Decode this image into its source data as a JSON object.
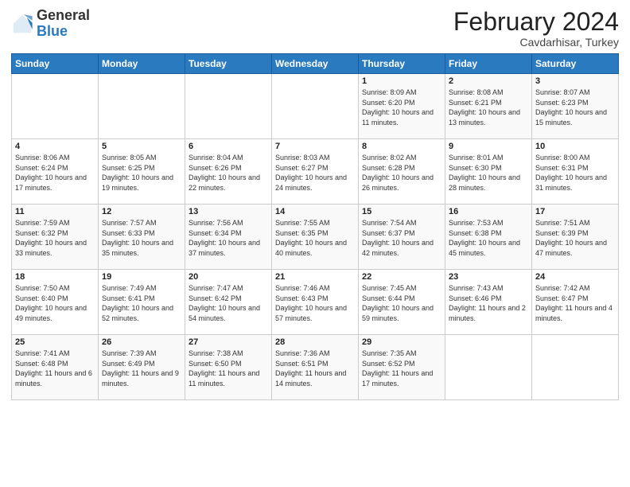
{
  "header": {
    "logo_general": "General",
    "logo_blue": "Blue",
    "month_year": "February 2024",
    "location": "Cavdarhisar, Turkey"
  },
  "days_of_week": [
    "Sunday",
    "Monday",
    "Tuesday",
    "Wednesday",
    "Thursday",
    "Friday",
    "Saturday"
  ],
  "weeks": [
    [
      {
        "day": "",
        "info": ""
      },
      {
        "day": "",
        "info": ""
      },
      {
        "day": "",
        "info": ""
      },
      {
        "day": "",
        "info": ""
      },
      {
        "day": "1",
        "info": "Sunrise: 8:09 AM\nSunset: 6:20 PM\nDaylight: 10 hours and 11 minutes."
      },
      {
        "day": "2",
        "info": "Sunrise: 8:08 AM\nSunset: 6:21 PM\nDaylight: 10 hours and 13 minutes."
      },
      {
        "day": "3",
        "info": "Sunrise: 8:07 AM\nSunset: 6:23 PM\nDaylight: 10 hours and 15 minutes."
      }
    ],
    [
      {
        "day": "4",
        "info": "Sunrise: 8:06 AM\nSunset: 6:24 PM\nDaylight: 10 hours and 17 minutes."
      },
      {
        "day": "5",
        "info": "Sunrise: 8:05 AM\nSunset: 6:25 PM\nDaylight: 10 hours and 19 minutes."
      },
      {
        "day": "6",
        "info": "Sunrise: 8:04 AM\nSunset: 6:26 PM\nDaylight: 10 hours and 22 minutes."
      },
      {
        "day": "7",
        "info": "Sunrise: 8:03 AM\nSunset: 6:27 PM\nDaylight: 10 hours and 24 minutes."
      },
      {
        "day": "8",
        "info": "Sunrise: 8:02 AM\nSunset: 6:28 PM\nDaylight: 10 hours and 26 minutes."
      },
      {
        "day": "9",
        "info": "Sunrise: 8:01 AM\nSunset: 6:30 PM\nDaylight: 10 hours and 28 minutes."
      },
      {
        "day": "10",
        "info": "Sunrise: 8:00 AM\nSunset: 6:31 PM\nDaylight: 10 hours and 31 minutes."
      }
    ],
    [
      {
        "day": "11",
        "info": "Sunrise: 7:59 AM\nSunset: 6:32 PM\nDaylight: 10 hours and 33 minutes."
      },
      {
        "day": "12",
        "info": "Sunrise: 7:57 AM\nSunset: 6:33 PM\nDaylight: 10 hours and 35 minutes."
      },
      {
        "day": "13",
        "info": "Sunrise: 7:56 AM\nSunset: 6:34 PM\nDaylight: 10 hours and 37 minutes."
      },
      {
        "day": "14",
        "info": "Sunrise: 7:55 AM\nSunset: 6:35 PM\nDaylight: 10 hours and 40 minutes."
      },
      {
        "day": "15",
        "info": "Sunrise: 7:54 AM\nSunset: 6:37 PM\nDaylight: 10 hours and 42 minutes."
      },
      {
        "day": "16",
        "info": "Sunrise: 7:53 AM\nSunset: 6:38 PM\nDaylight: 10 hours and 45 minutes."
      },
      {
        "day": "17",
        "info": "Sunrise: 7:51 AM\nSunset: 6:39 PM\nDaylight: 10 hours and 47 minutes."
      }
    ],
    [
      {
        "day": "18",
        "info": "Sunrise: 7:50 AM\nSunset: 6:40 PM\nDaylight: 10 hours and 49 minutes."
      },
      {
        "day": "19",
        "info": "Sunrise: 7:49 AM\nSunset: 6:41 PM\nDaylight: 10 hours and 52 minutes."
      },
      {
        "day": "20",
        "info": "Sunrise: 7:47 AM\nSunset: 6:42 PM\nDaylight: 10 hours and 54 minutes."
      },
      {
        "day": "21",
        "info": "Sunrise: 7:46 AM\nSunset: 6:43 PM\nDaylight: 10 hours and 57 minutes."
      },
      {
        "day": "22",
        "info": "Sunrise: 7:45 AM\nSunset: 6:44 PM\nDaylight: 10 hours and 59 minutes."
      },
      {
        "day": "23",
        "info": "Sunrise: 7:43 AM\nSunset: 6:46 PM\nDaylight: 11 hours and 2 minutes."
      },
      {
        "day": "24",
        "info": "Sunrise: 7:42 AM\nSunset: 6:47 PM\nDaylight: 11 hours and 4 minutes."
      }
    ],
    [
      {
        "day": "25",
        "info": "Sunrise: 7:41 AM\nSunset: 6:48 PM\nDaylight: 11 hours and 6 minutes."
      },
      {
        "day": "26",
        "info": "Sunrise: 7:39 AM\nSunset: 6:49 PM\nDaylight: 11 hours and 9 minutes."
      },
      {
        "day": "27",
        "info": "Sunrise: 7:38 AM\nSunset: 6:50 PM\nDaylight: 11 hours and 11 minutes."
      },
      {
        "day": "28",
        "info": "Sunrise: 7:36 AM\nSunset: 6:51 PM\nDaylight: 11 hours and 14 minutes."
      },
      {
        "day": "29",
        "info": "Sunrise: 7:35 AM\nSunset: 6:52 PM\nDaylight: 11 hours and 17 minutes."
      },
      {
        "day": "",
        "info": ""
      },
      {
        "day": "",
        "info": ""
      }
    ]
  ]
}
